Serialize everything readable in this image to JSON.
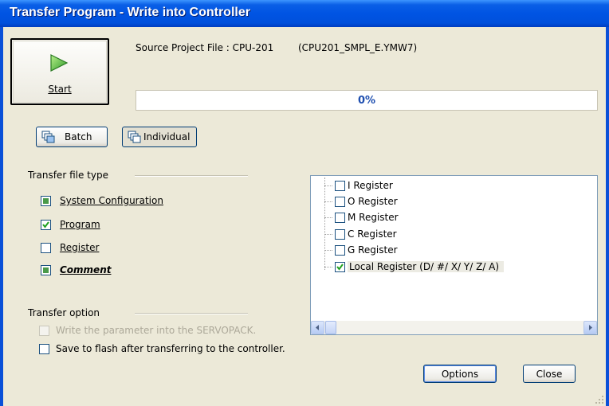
{
  "window": {
    "title": "Transfer Program - Write into Controller"
  },
  "start_button": {
    "label": "Start",
    "icon": "play-icon"
  },
  "source": {
    "label": "Source Project File : CPU-201",
    "file": "(CPU201_SMPL_E.YMW7)"
  },
  "progress": {
    "value": 0,
    "text": "0%"
  },
  "mode_buttons": {
    "batch": "Batch",
    "individual": "Individual"
  },
  "transfer_file_type": {
    "label": "Transfer file type",
    "items": [
      {
        "label": "System Configuration",
        "state": "indeterminate"
      },
      {
        "label": "Program",
        "state": "checked"
      },
      {
        "label": "Register",
        "state": "unchecked"
      },
      {
        "label": "Comment",
        "state": "indeterminate"
      }
    ]
  },
  "register_tree": {
    "items": [
      {
        "label": "I Register",
        "checked": false
      },
      {
        "label": "O Register",
        "checked": false
      },
      {
        "label": "M Register",
        "checked": false
      },
      {
        "label": "C Register",
        "checked": false
      },
      {
        "label": "G Register",
        "checked": false
      },
      {
        "label": "Local Register (D/ #/ X/ Y/ Z/ A)",
        "checked": true
      }
    ]
  },
  "transfer_option": {
    "label": "Transfer option",
    "servopack": "Write the parameter into the SERVOPACK.",
    "flash": "Save to flash after transferring to the controller."
  },
  "footer": {
    "options": "Options",
    "close": "Close"
  }
}
